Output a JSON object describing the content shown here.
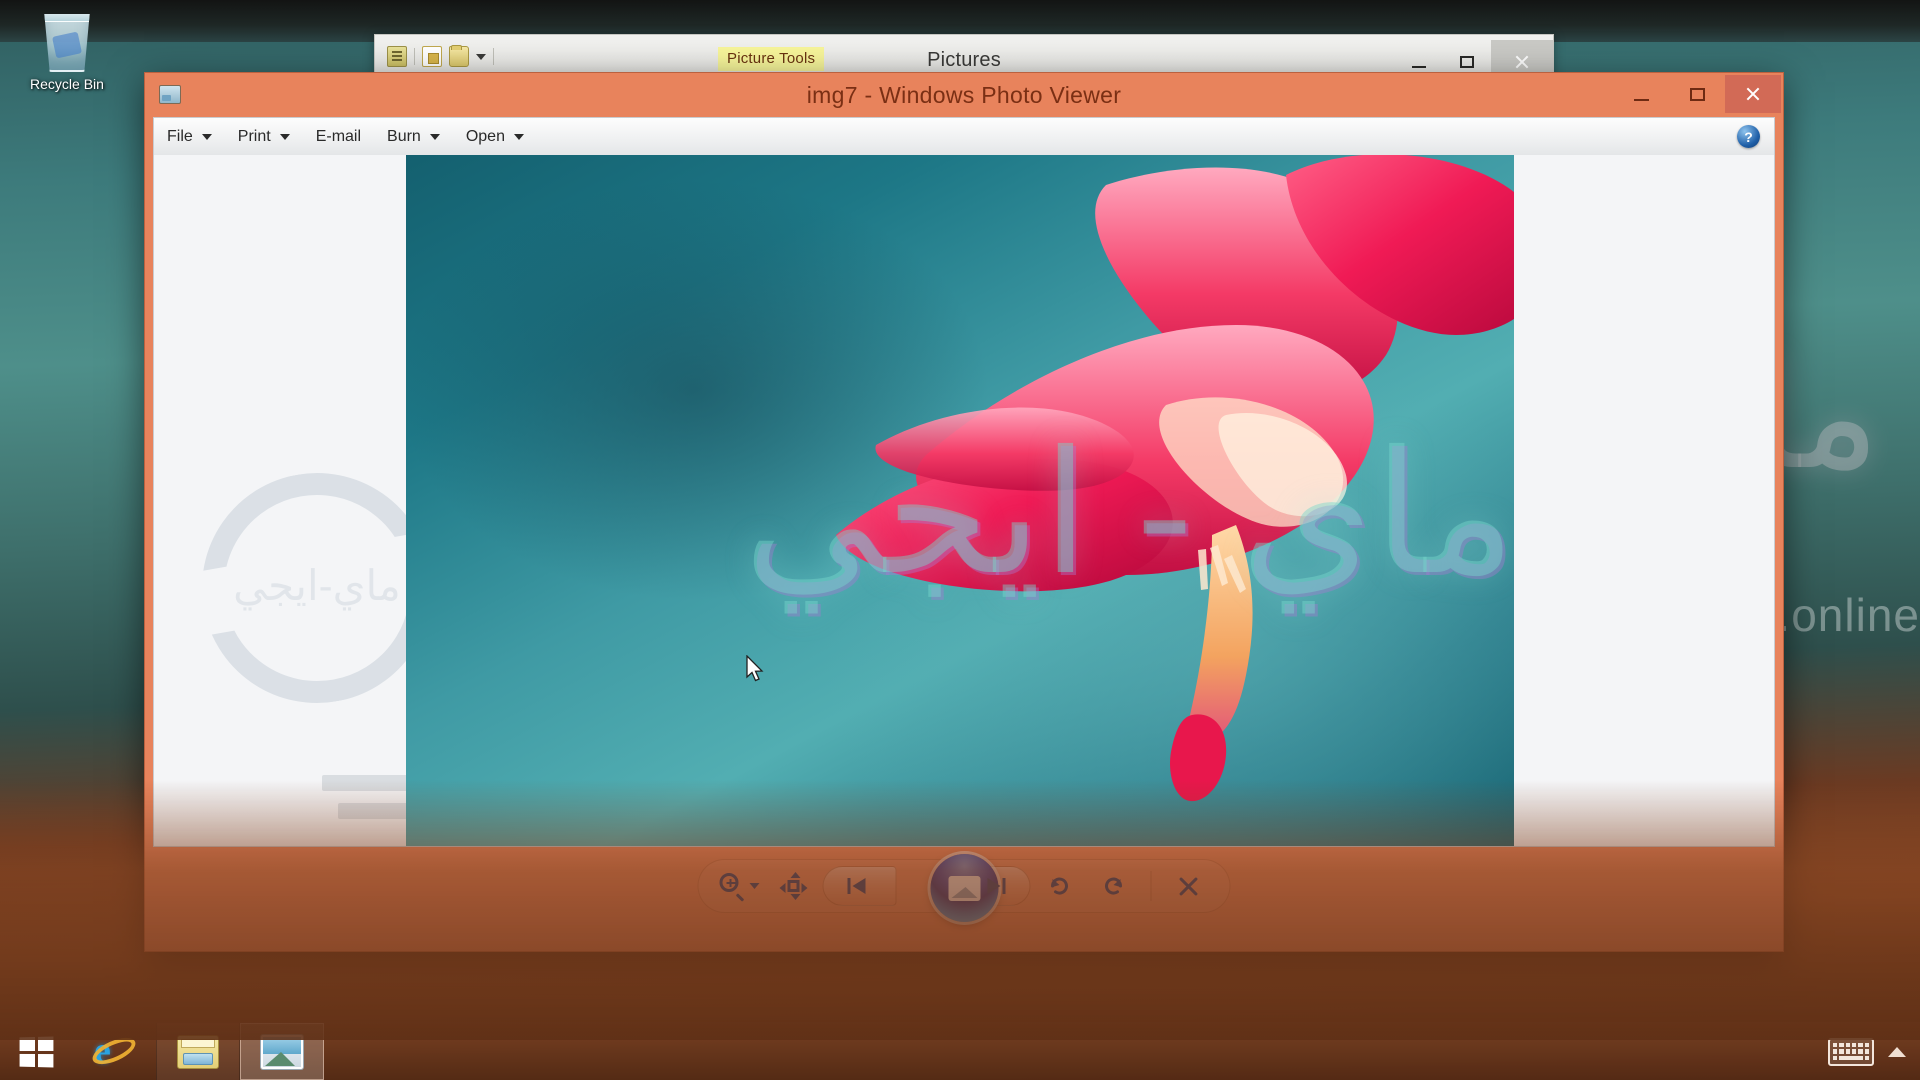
{
  "desktop": {
    "recycle_bin_label": "Recycle Bin",
    "watermark_arabic": "ماي - ايجي",
    "watermark_domain": "my-egy.online",
    "accent_orange": "#e8835c",
    "accent_blue": "#1a3a78"
  },
  "explorer": {
    "title": "Pictures",
    "ribbon_tab": "Picture Tools",
    "quick_access": [
      {
        "name": "properties-icon"
      },
      {
        "name": "new-folder-icon"
      },
      {
        "name": "folder-icon"
      },
      {
        "name": "customize-caret-icon"
      }
    ],
    "controls": {
      "minimize": "Minimize",
      "maximize": "Maximize",
      "close": "Close"
    }
  },
  "photo_viewer": {
    "title": "img7 - Windows Photo Viewer",
    "app_icon": "photo-viewer-icon",
    "menu": [
      {
        "label": "File",
        "caret": true
      },
      {
        "label": "Print",
        "caret": true
      },
      {
        "label": "E-mail",
        "caret": false
      },
      {
        "label": "Burn",
        "caret": true
      },
      {
        "label": "Open",
        "caret": true
      }
    ],
    "help_label": "?",
    "controls": {
      "minimize": "Minimize",
      "maximize": "Maximize",
      "close": "Close"
    },
    "canvas_watermark_arabic": "ماي-ايجي",
    "photo_watermark_arabic": "ماي - ايجي",
    "toolbar": [
      {
        "name": "zoom-button",
        "label": "Change the display size"
      },
      {
        "name": "fit-to-window-button",
        "label": "Fit picture to window"
      },
      {
        "name": "previous-button",
        "label": "Previous"
      },
      {
        "name": "play-slideshow-button",
        "label": "Play slide show (F11)"
      },
      {
        "name": "next-button",
        "label": "Next"
      },
      {
        "name": "rotate-counterclockwise-button",
        "label": "Rotate counterclockwise (Ctrl+,)"
      },
      {
        "name": "rotate-clockwise-button",
        "label": "Rotate clockwise (Ctrl+.)"
      },
      {
        "name": "delete-button",
        "label": "Delete"
      }
    ]
  },
  "taskbar": {
    "start_label": "Start",
    "items": [
      {
        "name": "taskbar-item-internet-explorer",
        "label": "Internet Explorer"
      },
      {
        "name": "taskbar-item-file-explorer",
        "label": "File Explorer"
      },
      {
        "name": "taskbar-item-photo-viewer",
        "label": "img7 - Windows Photo Viewer"
      }
    ],
    "tray": [
      {
        "name": "touch-keyboard-icon",
        "label": "Touch keyboard"
      },
      {
        "name": "show-hidden-icons-icon",
        "label": "Show hidden icons"
      }
    ]
  }
}
